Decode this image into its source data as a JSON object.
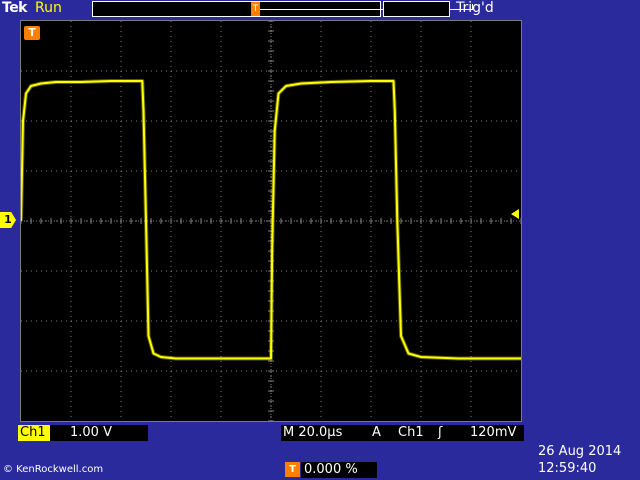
{
  "header": {
    "brand": "Tek",
    "run_state": "Run",
    "trigger_status": "Trig'd",
    "record_marker": "T"
  },
  "screen": {
    "trigger_position_marker": "T",
    "ch1_ground_marker": "1",
    "colors": {
      "trace": "#ffff00",
      "graticule": "#808080",
      "background": "#000000",
      "frame": "#2a2a9c",
      "marker": "#ff8000"
    },
    "grid": {
      "divisions_x": 10,
      "divisions_y": 8
    }
  },
  "channel": {
    "label": "Ch1",
    "scale": "1.00 V"
  },
  "timebase": "M 20.0µs",
  "trigger": {
    "mode": "A",
    "source": "Ch1",
    "slope_icon": "rising-edge-icon",
    "slope_glyph": "ʃ",
    "level": "120mV",
    "offset_marker": "T",
    "offset": "0.000 %"
  },
  "date": "26 Aug 2014",
  "time": "12:59:40",
  "copyright": "© KenRockwell.com",
  "chart_data": {
    "type": "line",
    "title": "",
    "xlabel": "",
    "ylabel": "",
    "x_unit": "µs",
    "y_unit": "V",
    "xlim": [
      0,
      200
    ],
    "ylim": [
      -4,
      4
    ],
    "series": [
      {
        "x": [
          0,
          0.8,
          2,
          4,
          8,
          14,
          24,
          36,
          48.5,
          49,
          50,
          51,
          53,
          56,
          62,
          75,
          100,
          100.5,
          101.5,
          103,
          106,
          112,
          124,
          140,
          149,
          149.5,
          150.5,
          152,
          155,
          160,
          175,
          200
        ],
        "y": [
          0,
          2,
          2.55,
          2.7,
          2.75,
          2.78,
          2.78,
          2.8,
          2.8,
          2.2,
          0,
          -2.3,
          -2.65,
          -2.72,
          -2.75,
          -2.75,
          -2.75,
          -0.5,
          1.8,
          2.55,
          2.7,
          2.75,
          2.78,
          2.8,
          2.8,
          2.2,
          0,
          -2.3,
          -2.65,
          -2.72,
          -2.75,
          -2.75
        ]
      }
    ]
  }
}
